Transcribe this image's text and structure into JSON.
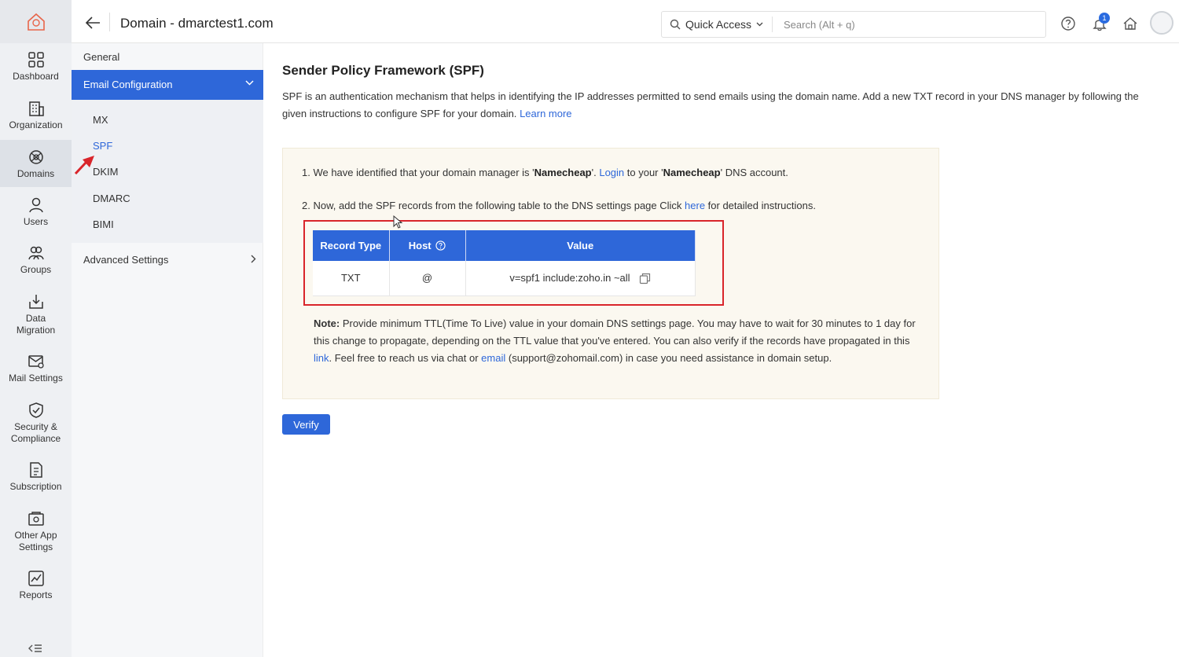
{
  "header": {
    "title": "Domain - dmarctest1.com",
    "quick_access_label": "Quick Access",
    "search_placeholder": "Search (Alt + q)",
    "notification_count": "1"
  },
  "rail": {
    "items": [
      {
        "label": "Dashboard",
        "icon": "dashboard-icon"
      },
      {
        "label": "Organization",
        "icon": "organization-icon"
      },
      {
        "label": "Domains",
        "icon": "domains-icon"
      },
      {
        "label": "Users",
        "icon": "users-icon"
      },
      {
        "label": "Groups",
        "icon": "groups-icon"
      },
      {
        "label": "Data",
        "label2": "Migration",
        "icon": "data-migration-icon"
      },
      {
        "label": "Mail Settings",
        "icon": "mail-settings-icon"
      },
      {
        "label": "Security &",
        "label2": "Compliance",
        "icon": "security-icon"
      },
      {
        "label": "Subscription",
        "icon": "subscription-icon"
      },
      {
        "label": "Other App",
        "label2": "Settings",
        "icon": "other-app-icon"
      },
      {
        "label": "Reports",
        "icon": "reports-icon"
      }
    ]
  },
  "subnav": {
    "general": "General",
    "email_configuration": "Email Configuration",
    "items": [
      "MX",
      "SPF",
      "DKIM",
      "DMARC",
      "BIMI"
    ],
    "active": "SPF",
    "advanced": "Advanced Settings"
  },
  "main": {
    "title": "Sender Policy Framework (SPF)",
    "desc": "SPF is an authentication mechanism that helps in identifying the IP addresses permitted to send emails using the domain name. Add a new TXT record in your DNS manager by following the given instructions to configure SPF for your domain.",
    "learn_more": "Learn more",
    "step1_a": "1. We have identified that your domain manager is '",
    "step1_b": "Namecheap",
    "step1_c": "'. ",
    "step1_login": "Login",
    "step1_d": " to your '",
    "step1_e": "Namecheap",
    "step1_f": "' DNS account.",
    "step2_a": "2. Now, add the SPF records from the following table to the DNS settings page Click ",
    "step2_here": "here",
    "step2_b": " for detailed instructions.",
    "table": {
      "headers": [
        "Record Type",
        "Host",
        "Value"
      ],
      "rows": [
        [
          "TXT",
          "@",
          "v=spf1 include:zoho.in ~all"
        ]
      ]
    },
    "note_label": "Note:",
    "note_a": " Provide minimum TTL(Time To Live) value in your domain DNS settings page. You may have to wait for 30 minutes to 1 day for this change to propagate, depending on the TTL value that you've entered. You can also verify if the records have propagated in this ",
    "note_link": "link",
    "note_b": ". Feel free to reach us via chat or ",
    "note_email": "email",
    "note_c": " (support@zohomail.com) in case you need assistance in domain setup.",
    "verify": "Verify"
  },
  "colors": {
    "accent": "#2e67d9",
    "highlight_box": "#d9252b",
    "panel_bg": "#fbf8f0"
  }
}
